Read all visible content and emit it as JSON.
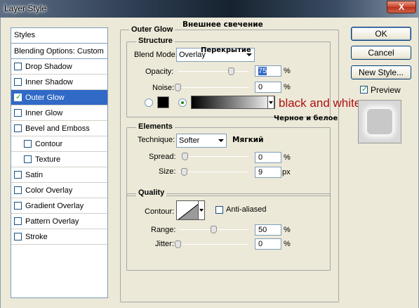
{
  "window": {
    "title": "Layer Style",
    "close_glyph": "X"
  },
  "styles_panel": {
    "header": "Styles",
    "blending": "Blending Options: Custom",
    "items": [
      {
        "label": "Drop Shadow",
        "checked": false,
        "selected": false,
        "sub": false
      },
      {
        "label": "Inner Shadow",
        "checked": false,
        "selected": false,
        "sub": false
      },
      {
        "label": "Outer Glow",
        "checked": true,
        "selected": true,
        "sub": false
      },
      {
        "label": "Inner Glow",
        "checked": false,
        "selected": false,
        "sub": false
      },
      {
        "label": "Bevel and Emboss",
        "checked": false,
        "selected": false,
        "sub": false
      },
      {
        "label": "Contour",
        "checked": false,
        "selected": false,
        "sub": true
      },
      {
        "label": "Texture",
        "checked": false,
        "selected": false,
        "sub": true
      },
      {
        "label": "Satin",
        "checked": false,
        "selected": false,
        "sub": false
      },
      {
        "label": "Color Overlay",
        "checked": false,
        "selected": false,
        "sub": false
      },
      {
        "label": "Gradient Overlay",
        "checked": false,
        "selected": false,
        "sub": false
      },
      {
        "label": "Pattern Overlay",
        "checked": false,
        "selected": false,
        "sub": false
      },
      {
        "label": "Stroke",
        "checked": false,
        "selected": false,
        "sub": false
      }
    ]
  },
  "outer_glow": {
    "title": "Outer Glow",
    "title_ru": "Внешнее свечение",
    "structure": {
      "title": "Structure",
      "blend_mode_label": "Blend Mode:",
      "blend_mode_value": "Overlay",
      "blend_mode_ru": "Перекрытие",
      "opacity_label": "Opacity:",
      "opacity_value": "75",
      "opacity_unit": "%",
      "opacity_fraction": 0.75,
      "noise_label": "Noise:",
      "noise_value": "0",
      "noise_unit": "%",
      "annotation": "black and white",
      "annotation_ru": "Черное и белое"
    },
    "elements": {
      "title": "Elements",
      "technique_label": "Technique:",
      "technique_value": "Softer",
      "technique_ru": "Мягкий",
      "spread_label": "Spread:",
      "spread_value": "0",
      "spread_unit": "%",
      "size_label": "Size:",
      "size_value": "9",
      "size_unit": "px"
    },
    "quality": {
      "title": "Quality",
      "contour_label": "Contour:",
      "anti_aliased_label": "Anti-aliased",
      "anti_aliased": false,
      "range_label": "Range:",
      "range_value": "50",
      "range_unit": "%",
      "range_fraction": 0.5,
      "jitter_label": "Jitter:",
      "jitter_value": "0",
      "jitter_unit": "%"
    }
  },
  "buttons": {
    "ok": "OK",
    "cancel": "Cancel",
    "new_style": "New Style...",
    "preview": "Preview"
  },
  "preview_checked": true,
  "colors": {
    "selection": "#3169c6",
    "annotation": "#b01010",
    "dialog_bg": "#ece9d8"
  }
}
